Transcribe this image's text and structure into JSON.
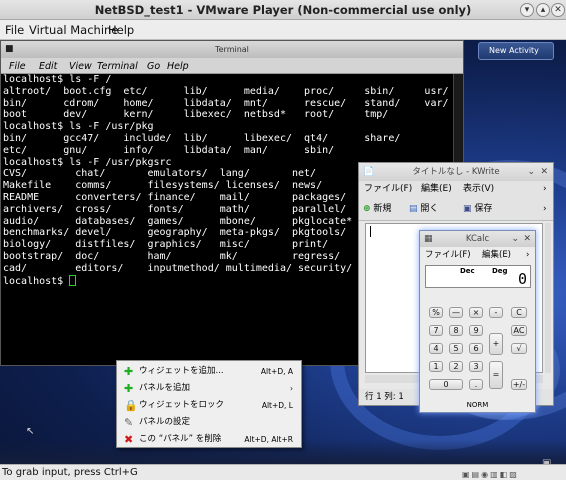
{
  "window": {
    "title": "NetBSD_test1 - VMware Player (Non-commercial use only)"
  },
  "host_menu": [
    {
      "label": "File"
    },
    {
      "label": "Virtual Machine"
    },
    {
      "label": "Help"
    }
  ],
  "host_status": "To grab input, press Ctrl+G",
  "desktop": {
    "new_activity": "New Activity"
  },
  "terminal": {
    "title": "Terminal",
    "menu": [
      "File",
      "Edit",
      "View",
      "Terminal",
      "Go",
      "Help"
    ],
    "lines": [
      "localhost$ ls -F /",
      "altroot/  boot.cfg  etc/      lib/      media/    proc/     sbin/     usr/",
      "bin/      cdrom/    home/     libdata/  mnt/      rescue/   stand/    var/",
      "boot      dev/      kern/     libexec/  netbsd*   root/     tmp/",
      "localhost$ ls -F /usr/pkg",
      "bin/      gcc47/    include/  lib/      libexec/  qt4/      share/",
      "etc/      gnu/      info/     libdata/  man/      sbin/",
      "localhost$ ls -F /usr/pkgsrc",
      "CVS/        chat/       emulators/  lang/       net/",
      "Makefile    comms/      filesystems/ licenses/  news/",
      "README      converters/ finance/    mail/       packages/",
      "archivers/  cross/      fonts/      math/       parallel/",
      "audio/      databases/  games/      mbone/      pkglocate*",
      "benchmarks/ devel/      geography/  meta-pkgs/  pkgtools/",
      "biology/    distfiles/  graphics/   misc/       print/",
      "bootstrap/  doc/        ham/        mk/         regress/",
      "cad/        editors/    inputmethod/ multimedia/ security/"
    ],
    "prompt": "localhost$ "
  },
  "kwrite": {
    "title": "タイトルなし - KWrite",
    "menu": [
      "ファイル(F)",
      "編集(E)",
      "表示(V)"
    ],
    "toolbar": [
      "新規",
      "開く",
      "保存"
    ],
    "status": "行  1  列: 1"
  },
  "kcalc": {
    "title": "KCalc",
    "menu": [
      "ファイル(F)",
      "編集(E)"
    ],
    "mode_left": "Dec",
    "mode_right": "Deg",
    "display": "0",
    "keys": [
      "%",
      "—",
      "×",
      "-",
      "C",
      "7",
      "8",
      "9",
      "AC",
      "4",
      "5",
      "6",
      "+",
      "√",
      "1",
      "2",
      "3",
      "0",
      ".",
      "+/-"
    ],
    "norm": "NORM"
  },
  "context_menu": {
    "items": [
      {
        "label": "ウィジェットを追加...",
        "shortcut": "Alt+D, A",
        "icon": "plus-icon"
      },
      {
        "label": "パネルを追加",
        "shortcut": "",
        "icon": "plus-icon"
      },
      {
        "label": "ウィジェットをロック",
        "shortcut": "Alt+D, L",
        "icon": "lock-icon"
      },
      {
        "label": "パネルの設定",
        "shortcut": "",
        "icon": "wrench-icon"
      },
      {
        "label": "この “パネル” を削除",
        "shortcut": "Alt+D, Alt+R",
        "icon": "delete-icon"
      }
    ]
  },
  "colors": {
    "terminal_bg": "#000000",
    "terminal_fg": "#ffffff",
    "cursor": "#2ed02e",
    "wallpaper": "#1e3e8e"
  }
}
